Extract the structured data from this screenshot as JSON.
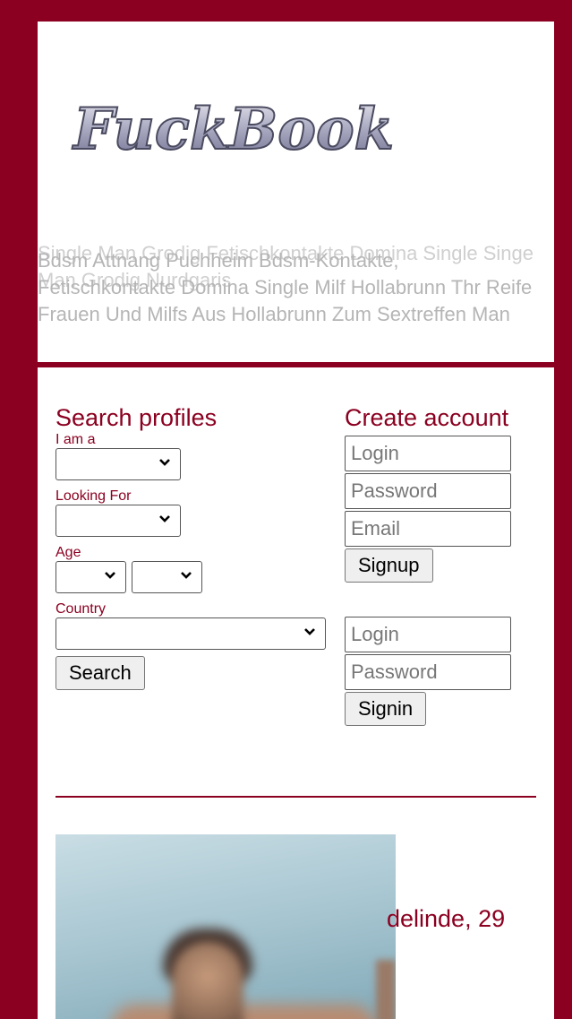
{
  "header": {
    "logo_text": "FuckBook",
    "overlay_text_1": "Single Man Grodig Fetischkontakte Domina Single Singe Man Grodig Nurdgaris",
    "overlay_text_2": "Bdsm Attnang Puchheim Bdsm-Kontakte, Fetischkontakte Domina Single Milf Hollabrunn Thr Reife Frauen Und Milfs Aus Hollabrunn Zum Sextreffen Man"
  },
  "search": {
    "title": "Search profiles",
    "i_am_label": "I am a",
    "looking_for_label": "Looking For",
    "age_label": "Age",
    "country_label": "Country",
    "search_button": "Search"
  },
  "account": {
    "title": "Create account",
    "login_placeholder": "Login",
    "password_placeholder": "Password",
    "email_placeholder": "Email",
    "signup_button": "Signup",
    "signin_login_placeholder": "Login",
    "signin_password_placeholder": "Password",
    "signin_button": "Signin"
  },
  "profile": {
    "name_age": "delinde, 29"
  },
  "colors": {
    "accent": "#8b0020",
    "background": "#ffffff"
  },
  "icons": {
    "select_arrow": "chevron-down-icon"
  }
}
